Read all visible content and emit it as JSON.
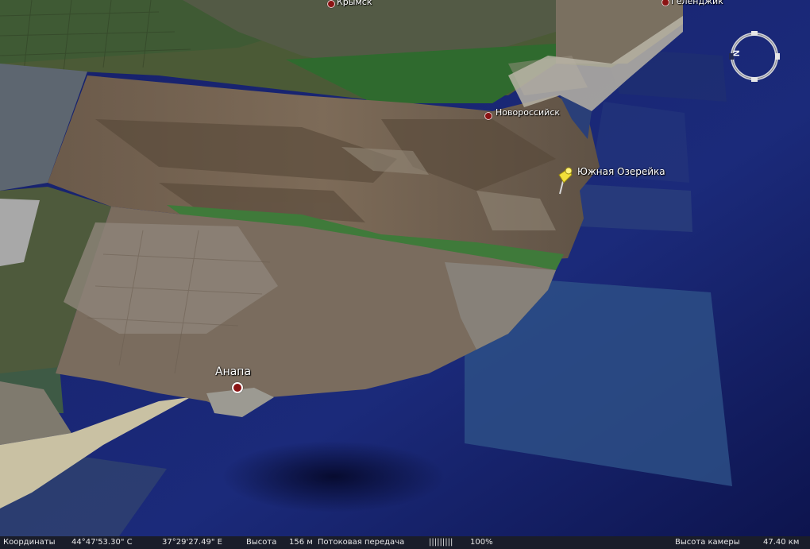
{
  "places": {
    "krymsk": "Крымск",
    "gelendzhik": "Геленджик",
    "novorossiysk": "Новороссийск",
    "yuzhnaya_ozereyka": "Южная Озерейка",
    "anapa": "Анапа"
  },
  "compass": {
    "north_letter": "N"
  },
  "status": {
    "coords_label": "Координаты",
    "lat": "44°47'53.30\" С",
    "lon": "37°29'27.49\" Е",
    "elev_label": "Высота",
    "elev_value": "156 м",
    "stream_label": "Потоковая передача",
    "stream_bar": "|||||||||",
    "stream_pct": "100%",
    "cam_label": "Высота камеры",
    "cam_value": "47.40 км"
  },
  "colors": {
    "sea": "#1e2a74",
    "land": "#6e6050",
    "placemark": "#f3e03a",
    "city_dot": "#8a1414"
  }
}
